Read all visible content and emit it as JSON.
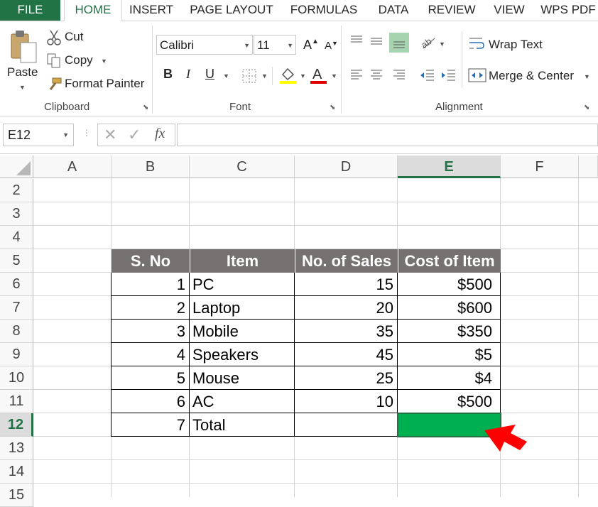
{
  "tabs": [
    "FILE",
    "HOME",
    "INSERT",
    "PAGE LAYOUT",
    "FORMULAS",
    "DATA",
    "REVIEW",
    "VIEW",
    "WPS PDF"
  ],
  "active_tab": "HOME",
  "clipboard": {
    "paste": "Paste",
    "cut": "Cut",
    "copy": "Copy",
    "format_painter": "Format Painter",
    "label": "Clipboard"
  },
  "font": {
    "name": "Calibri",
    "size": "11",
    "label": "Font",
    "bold": "B",
    "italic": "I",
    "underline": "U",
    "highlight_color": "#ffff00",
    "font_color": "#e00000"
  },
  "alignment": {
    "wrap_text": "Wrap Text",
    "merge_center": "Merge & Center",
    "label": "Alignment"
  },
  "formula_bar": {
    "name_box": "E12",
    "fx": "fx",
    "formula": ""
  },
  "columns": [
    "A",
    "B",
    "C",
    "D",
    "E",
    "F"
  ],
  "selected_column": "E",
  "rows": [
    "2",
    "3",
    "4",
    "5",
    "6",
    "7",
    "8",
    "9",
    "10",
    "11",
    "12",
    "13",
    "14",
    "15"
  ],
  "selected_row": "12",
  "table": {
    "headers": [
      "S. No",
      "Item",
      "No. of Sales",
      "Cost of Item"
    ],
    "rows": [
      [
        "1",
        "PC",
        "15",
        "$500"
      ],
      [
        "2",
        "Laptop",
        "20",
        "$600"
      ],
      [
        "3",
        "Mobile",
        "35",
        "$350"
      ],
      [
        "4",
        "Speakers",
        "45",
        "$5"
      ],
      [
        "5",
        "Mouse",
        "25",
        "$4"
      ],
      [
        "6",
        "AC",
        "10",
        "$500"
      ],
      [
        "7",
        "Total",
        "",
        ""
      ]
    ]
  },
  "colors": {
    "accent": "#217346",
    "header_fill": "#767171",
    "selected_cell_fill": "#00b050",
    "arrow": "#ff0000"
  }
}
